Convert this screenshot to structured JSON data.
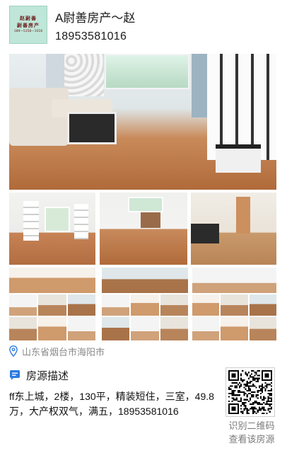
{
  "agent": {
    "logo_line1": "赵尉善",
    "logo_line2": "尉善房产",
    "logo_line3": "189—5358—1016",
    "name": "A尉善房产～赵",
    "phone": "18953581016"
  },
  "photos": {
    "main_alt": "living-room",
    "thumbs": [
      "living-room-shelves",
      "empty-room",
      "kitchen"
    ]
  },
  "location": {
    "icon": "location-pin-icon",
    "text": "山东省烟台市海阳市"
  },
  "section": {
    "icon": "chat-bubble-icon",
    "title": "房源描述"
  },
  "description": {
    "text": "ff东上城，2楼，130平，精装短住，三室，49.8万，大产权双气，满五，18953581016"
  },
  "qr": {
    "icon": "qr-code-icon",
    "caption_line1": "识别二维码",
    "caption_line2": "查看该房源"
  },
  "colors": {
    "accent_blue": "#2d7be0",
    "logo_bg": "#bfe6d8",
    "muted_text": "#8a8a8a"
  }
}
